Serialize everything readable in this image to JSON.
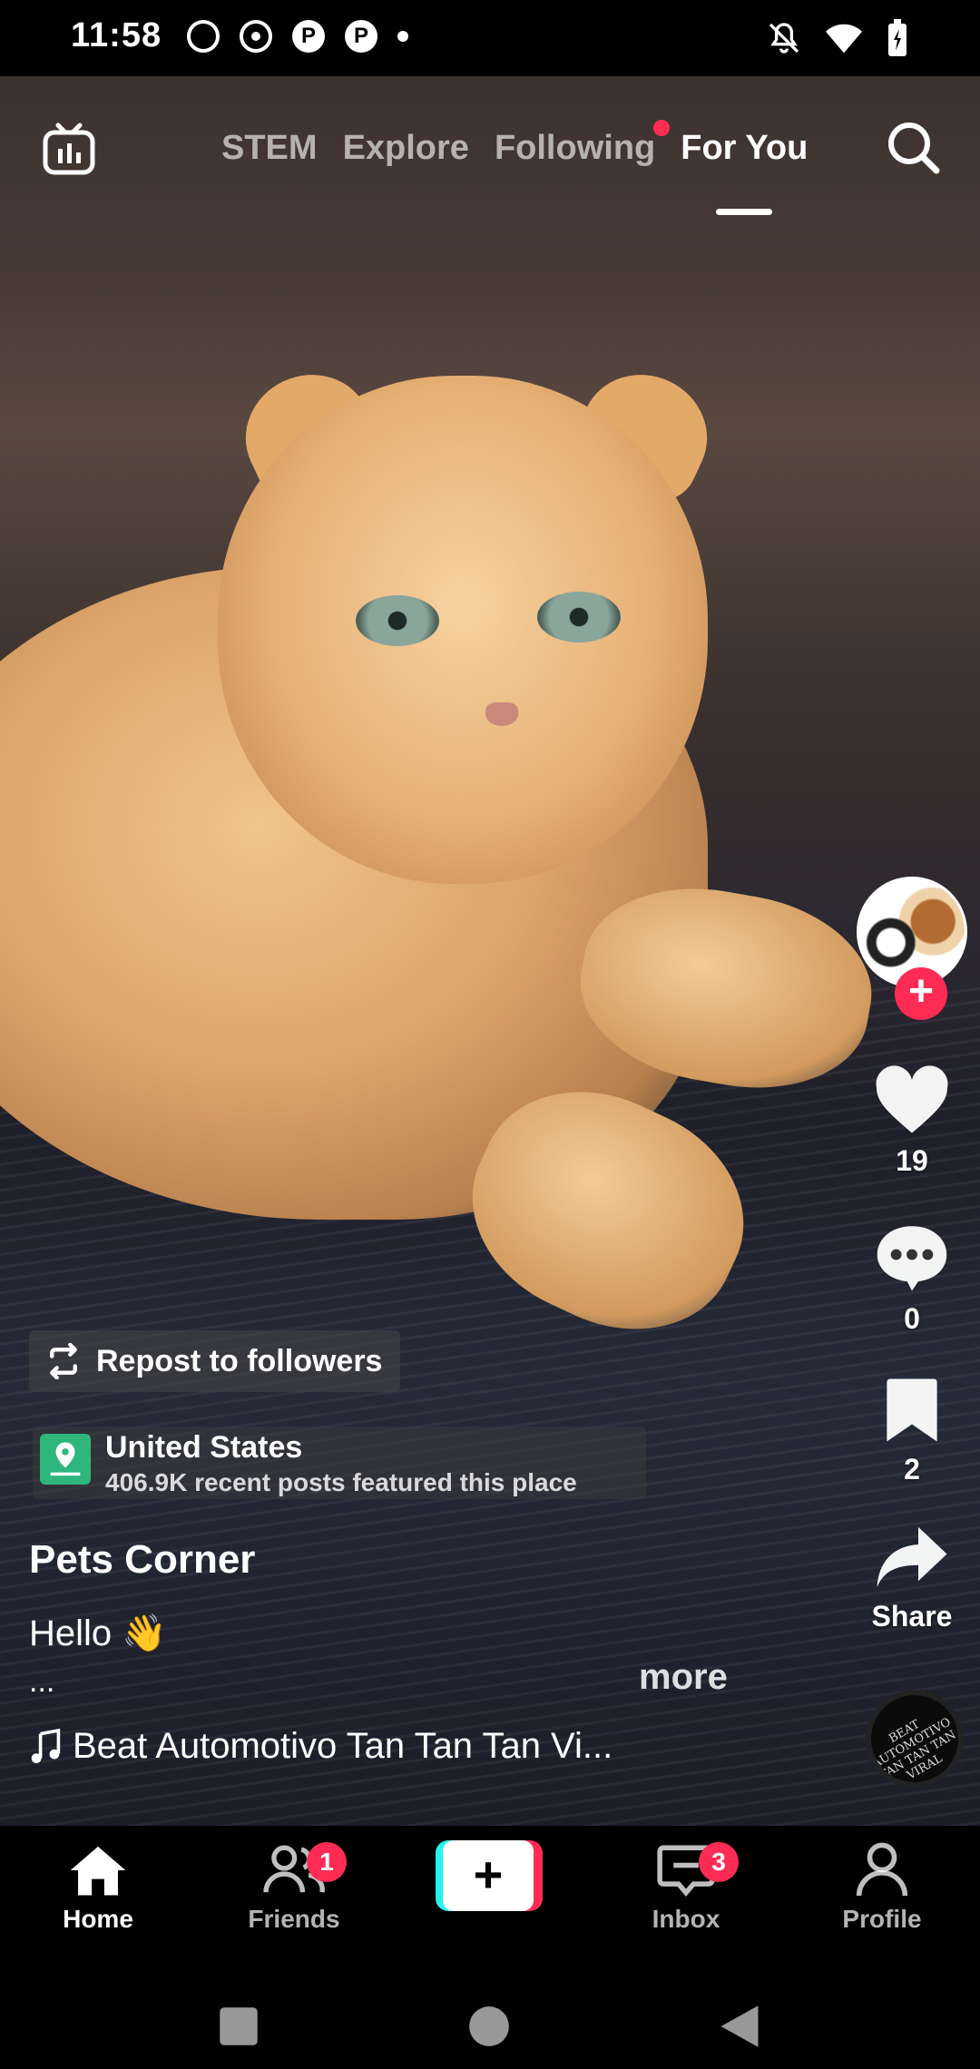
{
  "status_bar": {
    "time": "11:58"
  },
  "top_nav": {
    "tabs": [
      {
        "label": "STEM",
        "active": false
      },
      {
        "label": "Explore",
        "active": false
      },
      {
        "label": "Following",
        "active": false,
        "has_dot": true
      },
      {
        "label": "For You",
        "active": true
      }
    ],
    "icons": [
      "live-tv-icon",
      "search-icon"
    ]
  },
  "rail": {
    "likes": "19",
    "comments": "0",
    "bookmarks": "2",
    "share_label": "Share",
    "disc_text": "BEAT AUTOMOTIVO TAN TAN TAN VIRAL"
  },
  "post": {
    "repost_label": "Repost to followers",
    "location_title": "United States",
    "location_sub": "406.9K recent posts featured this place",
    "author": "Pets Corner",
    "caption": "Hello 👋",
    "caption_overflow": "...",
    "more_label": "more",
    "music": "Beat Automotivo Tan Tan Tan Vi..."
  },
  "bottom_nav": {
    "home": "Home",
    "friends": "Friends",
    "friends_badge": "1",
    "create": "+",
    "inbox": "Inbox",
    "inbox_badge": "3",
    "profile": "Profile"
  },
  "colors": {
    "accent": "#fe2c55",
    "teal": "#25f4ee",
    "location_green": "#2fb67c"
  }
}
